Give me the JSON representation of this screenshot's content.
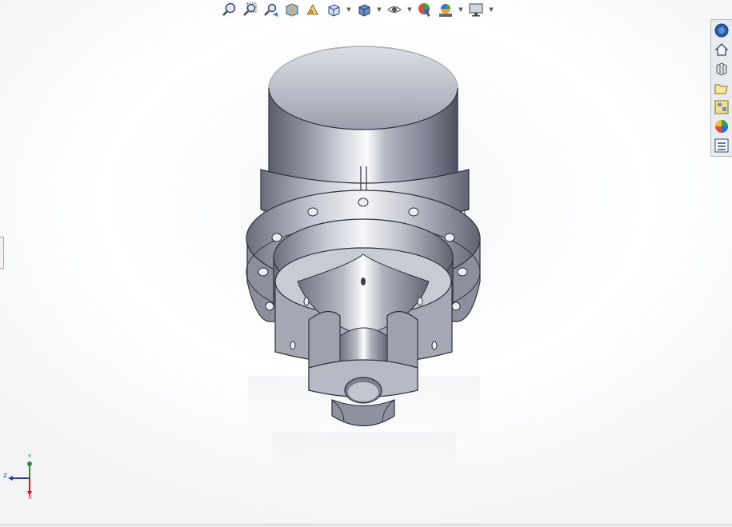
{
  "toolbar": {
    "buttons": [
      {
        "name": "zoom-to-fit",
        "icon": "zoom-to-fit-icon"
      },
      {
        "name": "zoom-to-area",
        "icon": "zoom-to-area-icon"
      },
      {
        "name": "previous-view",
        "icon": "previous-view-icon"
      },
      {
        "name": "section-view",
        "icon": "section-view-icon"
      },
      {
        "name": "dynamic-annotation-views",
        "icon": "annotation-view-icon"
      },
      {
        "name": "view-orientation",
        "icon": "view-orientation-icon",
        "dropdown": true
      },
      {
        "name": "display-style",
        "icon": "display-style-icon",
        "dropdown": true
      },
      {
        "name": "hide-show-items",
        "icon": "eye-icon",
        "dropdown": true
      },
      {
        "name": "edit-appearance",
        "icon": "edit-appearance-icon"
      },
      {
        "name": "apply-scene",
        "icon": "scene-icon",
        "dropdown": true
      },
      {
        "name": "view-settings",
        "icon": "monitor-icon",
        "dropdown": true
      }
    ]
  },
  "task_pane": {
    "tabs": [
      {
        "name": "solidworks-resources",
        "icon": "resources-icon"
      },
      {
        "name": "home",
        "icon": "home-icon"
      },
      {
        "name": "design-library",
        "icon": "design-library-icon"
      },
      {
        "name": "file-explorer",
        "icon": "folder-icon"
      },
      {
        "name": "view-palette",
        "icon": "view-palette-icon"
      },
      {
        "name": "appearances-scenes",
        "icon": "appearances-icon"
      },
      {
        "name": "custom-properties",
        "icon": "custom-properties-icon"
      }
    ]
  },
  "triad": {
    "y": "Y",
    "z": "Z",
    "x": "X"
  },
  "colors": {
    "metal_dark": "#5c6070",
    "metal_light": "#f2f4f8",
    "triad_y": "#2e8b2e",
    "triad_z": "#1e3fa8",
    "triad_x": "#c82020"
  }
}
